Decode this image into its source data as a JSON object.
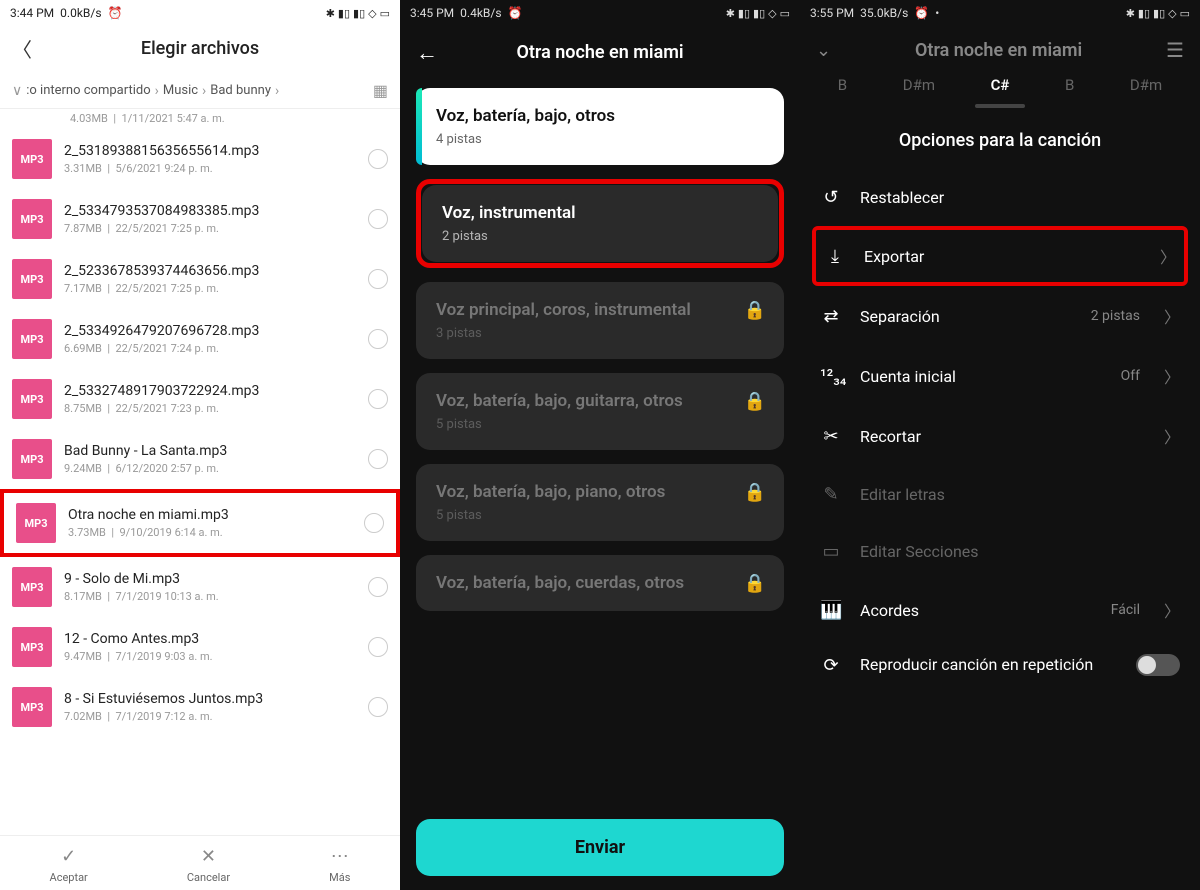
{
  "screen1": {
    "status": {
      "time": "3:44 PM",
      "rate": "0.0kB/s"
    },
    "header": {
      "title": "Elegir archivos"
    },
    "breadcrumb": {
      "part1": ":o interno compartido",
      "part2": "Music",
      "part3": "Bad bunny"
    },
    "partial_row": {
      "size": "4.03MB",
      "date": "1/11/2021 5:47 a. m."
    },
    "files": [
      {
        "name": "2_5318938815635655614.mp3",
        "size": "3.31MB",
        "date": "5/6/2021 9:24 p. m.",
        "highlight": false
      },
      {
        "name": "2_5334793537084983385.mp3",
        "size": "7.87MB",
        "date": "22/5/2021 7:25 p. m.",
        "highlight": false
      },
      {
        "name": "2_5233678539374463656.mp3",
        "size": "7.17MB",
        "date": "22/5/2021 7:25 p. m.",
        "highlight": false
      },
      {
        "name": "2_5334926479207696728.mp3",
        "size": "6.69MB",
        "date": "22/5/2021 7:24 p. m.",
        "highlight": false
      },
      {
        "name": "2_5332748917903722924.mp3",
        "size": "8.75MB",
        "date": "22/5/2021 7:23 p. m.",
        "highlight": false
      },
      {
        "name": "Bad Bunny - La Santa.mp3",
        "size": "9.24MB",
        "date": "6/12/2020 2:57 p. m.",
        "highlight": false
      },
      {
        "name": "Otra noche en miami.mp3",
        "size": "3.73MB",
        "date": "9/10/2019 6:14 a. m.",
        "highlight": true
      },
      {
        "name": "9 - Solo de Mi.mp3",
        "size": "8.17MB",
        "date": "7/1/2019 10:13 a. m.",
        "highlight": false
      },
      {
        "name": "12 - Como Antes.mp3",
        "size": "9.47MB",
        "date": "7/1/2019 9:03 a. m.",
        "highlight": false
      },
      {
        "name": "8 - Si Estuviésemos Juntos.mp3",
        "size": "7.02MB",
        "date": "7/1/2019 7:12 a. m.",
        "highlight": false
      }
    ],
    "bottom": {
      "accept": "Aceptar",
      "cancel": "Cancelar",
      "more": "Más"
    },
    "thumb_label": "MP3"
  },
  "screen2": {
    "status": {
      "time": "3:45 PM",
      "rate": "0.4kB/s"
    },
    "header": {
      "title": "Otra noche en miami"
    },
    "cards": [
      {
        "label": "Voz, batería, bajo, otros",
        "sub": "4 pistas",
        "style": "white",
        "locked": false,
        "highlight": false
      },
      {
        "label": "Voz, instrumental",
        "sub": "2 pistas",
        "style": "dark",
        "locked": false,
        "highlight": true
      },
      {
        "label": "Voz principal, coros, instrumental",
        "sub": "3 pistas",
        "style": "locked",
        "locked": true,
        "highlight": false
      },
      {
        "label": "Voz, batería, bajo, guitarra, otros",
        "sub": "5 pistas",
        "style": "locked",
        "locked": true,
        "highlight": false
      },
      {
        "label": "Voz, batería, bajo, piano, otros",
        "sub": "5 pistas",
        "style": "locked",
        "locked": true,
        "highlight": false
      },
      {
        "label": "Voz, batería, bajo, cuerdas, otros",
        "sub": "",
        "style": "locked",
        "locked": true,
        "highlight": false
      }
    ],
    "send": "Enviar"
  },
  "screen3": {
    "status": {
      "time": "3:55 PM",
      "rate": "35.0kB/s"
    },
    "header": {
      "title": "Otra noche en miami"
    },
    "keys": [
      "B",
      "D#m",
      "C#",
      "B",
      "D#m"
    ],
    "active_key_index": 2,
    "panel_title": "Opciones para la canción",
    "rows": [
      {
        "icon": "reset",
        "label": "Restablecer",
        "value": "",
        "chev": false,
        "disabled": false,
        "highlight": false
      },
      {
        "icon": "export",
        "label": "Exportar",
        "value": "",
        "chev": true,
        "disabled": false,
        "highlight": true
      },
      {
        "icon": "separate",
        "label": "Separación",
        "value": "2 pistas",
        "chev": true,
        "disabled": false,
        "highlight": false
      },
      {
        "icon": "count",
        "label": "Cuenta inicial",
        "value": "Off",
        "chev": true,
        "disabled": false,
        "highlight": false
      },
      {
        "icon": "trim",
        "label": "Recortar",
        "value": "",
        "chev": true,
        "disabled": false,
        "highlight": false
      },
      {
        "icon": "edit",
        "label": "Editar letras",
        "value": "",
        "chev": false,
        "disabled": true,
        "highlight": false
      },
      {
        "icon": "sections",
        "label": "Editar Secciones",
        "value": "",
        "chev": false,
        "disabled": true,
        "highlight": false
      },
      {
        "icon": "chords",
        "label": "Acordes",
        "value": "Fácil",
        "chev": true,
        "disabled": false,
        "highlight": false
      }
    ],
    "repeat": {
      "label": "Reproducir canción en repetición",
      "on": false
    }
  }
}
